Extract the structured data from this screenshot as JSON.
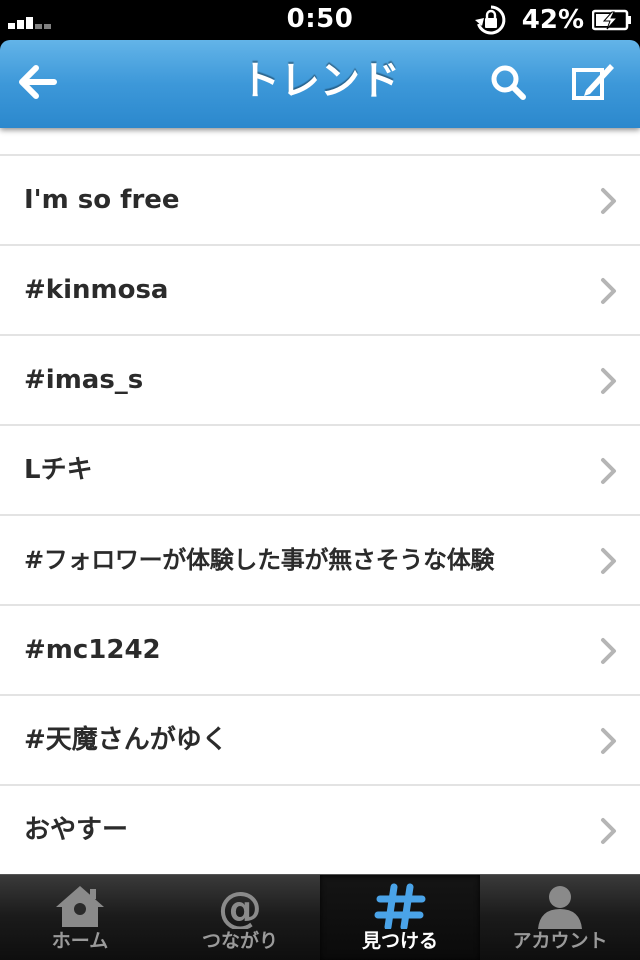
{
  "status_bar": {
    "time": "0:50",
    "battery_percent": "42%"
  },
  "nav": {
    "title": "トレンド",
    "back_icon": "back-arrow-icon",
    "search_icon": "search-icon",
    "compose_icon": "compose-icon"
  },
  "trends": [
    {
      "label": "I'm so free"
    },
    {
      "label": "#kinmosa"
    },
    {
      "label": "#imas_s"
    },
    {
      "label": "Lチキ"
    },
    {
      "label": "#フォロワーが体験した事が無さそうな体験"
    },
    {
      "label": "#mc1242"
    },
    {
      "label": "#天魔さんがゆく"
    },
    {
      "label": "おやすー"
    }
  ],
  "tabs": [
    {
      "label": "ホーム",
      "icon": "home-icon",
      "active": false
    },
    {
      "label": "つながり",
      "icon": "at-icon",
      "active": false
    },
    {
      "label": "見つける",
      "icon": "hashtag-icon",
      "active": true
    },
    {
      "label": "アカウント",
      "icon": "person-icon",
      "active": false
    }
  ],
  "colors": {
    "nav_blue": "#3d98d9",
    "active_tab_icon": "#4aa3e8"
  }
}
